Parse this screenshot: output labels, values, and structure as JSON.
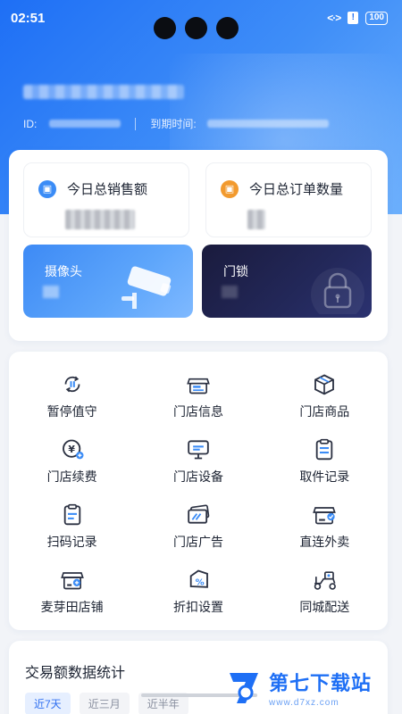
{
  "status_bar": {
    "time": "02:51",
    "battery": "100",
    "alert": "!"
  },
  "header": {
    "id_label": "ID:",
    "expiry_label": "到期时间:"
  },
  "stats": {
    "sales_title": "今日总销售额",
    "orders_title": "今日总订单数量"
  },
  "devices": {
    "camera_label": "摄像头",
    "lock_label": "门锁"
  },
  "menu": {
    "items": [
      {
        "label": "暂停值守",
        "icon": "pause-cycle-icon"
      },
      {
        "label": "门店信息",
        "icon": "store-info-icon"
      },
      {
        "label": "门店商品",
        "icon": "cube-icon"
      },
      {
        "label": "门店续费",
        "icon": "yen-renew-icon"
      },
      {
        "label": "门店设备",
        "icon": "monitor-icon"
      },
      {
        "label": "取件记录",
        "icon": "clipboard-icon"
      },
      {
        "label": "扫码记录",
        "icon": "scan-record-icon"
      },
      {
        "label": "门店广告",
        "icon": "ad-card-icon"
      },
      {
        "label": "直连外卖",
        "icon": "delivery-store-icon"
      },
      {
        "label": "麦芽田店铺",
        "icon": "maiyatian-store-icon"
      },
      {
        "label": "折扣设置",
        "icon": "discount-icon"
      },
      {
        "label": "同城配送",
        "icon": "scooter-icon"
      }
    ]
  },
  "trade": {
    "title": "交易额数据统计",
    "tabs": [
      "近7天",
      "近三月",
      "近半年"
    ]
  },
  "watermark": {
    "title": "第七下载站",
    "url": "www.d7xz.com"
  },
  "colors": {
    "brand_blue": "#1e6ff5",
    "lock_dark": "#1a1b3d",
    "icon_stroke": "#2b3142",
    "icon_accent": "#3b8cf6"
  }
}
